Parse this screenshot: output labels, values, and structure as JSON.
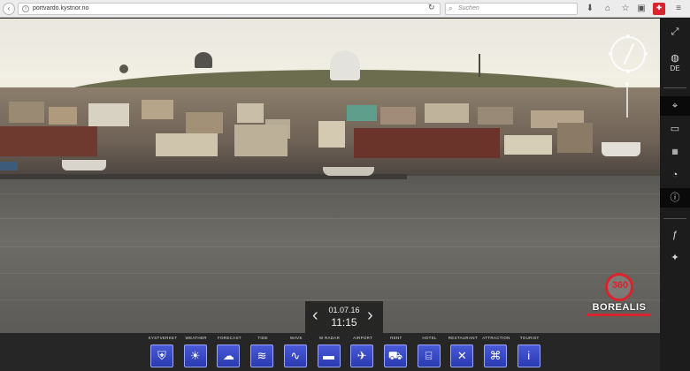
{
  "browser": {
    "url": "portvardo.kystnor.no",
    "search_placeholder": "Suchen",
    "icons": [
      "reload-icon",
      "download-icon",
      "home-icon",
      "bookmark-star-icon",
      "save-icon",
      "extension-icon",
      "menu-icon"
    ]
  },
  "camera": {
    "date": "01.07.16",
    "time": "11:15",
    "prev_label": "‹",
    "next_label": "›"
  },
  "logo": {
    "number": "360",
    "word": "BOREALIS"
  },
  "sidebar": {
    "language": "DE"
  },
  "bottom_nav": {
    "items": [
      {
        "label": "KYSTVERKET",
        "icon": "shield-icon",
        "glyph": "⛨"
      },
      {
        "label": "WEATHER",
        "icon": "weather-icon",
        "glyph": "☀"
      },
      {
        "label": "FORECAST",
        "icon": "forecast-icon",
        "glyph": "☁"
      },
      {
        "label": "TIDE",
        "icon": "tide-icon",
        "glyph": "≋"
      },
      {
        "label": "WAVE",
        "icon": "wave-icon",
        "glyph": "∿"
      },
      {
        "label": "W RADAR",
        "icon": "radar-icon",
        "glyph": "▬"
      },
      {
        "label": "AIRPORT",
        "icon": "airplane-icon",
        "glyph": "✈"
      },
      {
        "label": "RENT",
        "icon": "car-icon",
        "glyph": "⛟"
      },
      {
        "label": "HOTEL",
        "icon": "bed-icon",
        "glyph": "⌸"
      },
      {
        "label": "RESTAURANT",
        "icon": "fork-knife-icon",
        "glyph": "✕"
      },
      {
        "label": "ATTRACTION",
        "icon": "attraction-icon",
        "glyph": "⌘"
      },
      {
        "label": "TOURIST",
        "icon": "info-icon",
        "glyph": "i"
      }
    ]
  },
  "colors": {
    "accent_red": "#d9232d",
    "nav_tile_blue": "#3a4ad0"
  }
}
